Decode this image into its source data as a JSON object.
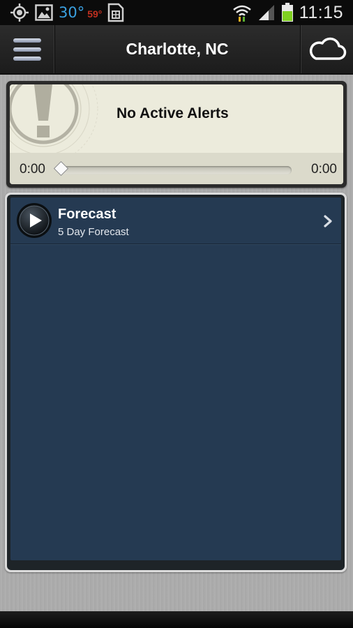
{
  "status_bar": {
    "icons_left": [
      "gps-icon",
      "gallery-icon",
      "weather-temp",
      "sim-icon"
    ],
    "temp_current": "30°",
    "temp_low": "59°",
    "icons_right": [
      "wifi-icon",
      "signal-icon",
      "battery-icon"
    ],
    "time": "11:15"
  },
  "header": {
    "title": "Charlotte, NC",
    "menu_icon": "hamburger-icon",
    "right_icon": "cloud-icon"
  },
  "alerts": {
    "message": "No Active Alerts",
    "icon": "exclamation-icon",
    "player": {
      "elapsed": "0:00",
      "duration": "0:00",
      "progress": 0
    }
  },
  "forecast_list": {
    "items": [
      {
        "title": "Forecast",
        "subtitle": "5 Day Forecast",
        "icon": "play-icon"
      }
    ]
  },
  "colors": {
    "header_bg": "#222222",
    "alert_bg": "#ecebdc",
    "list_bg": "#253a52",
    "battery": "#7fd020"
  }
}
